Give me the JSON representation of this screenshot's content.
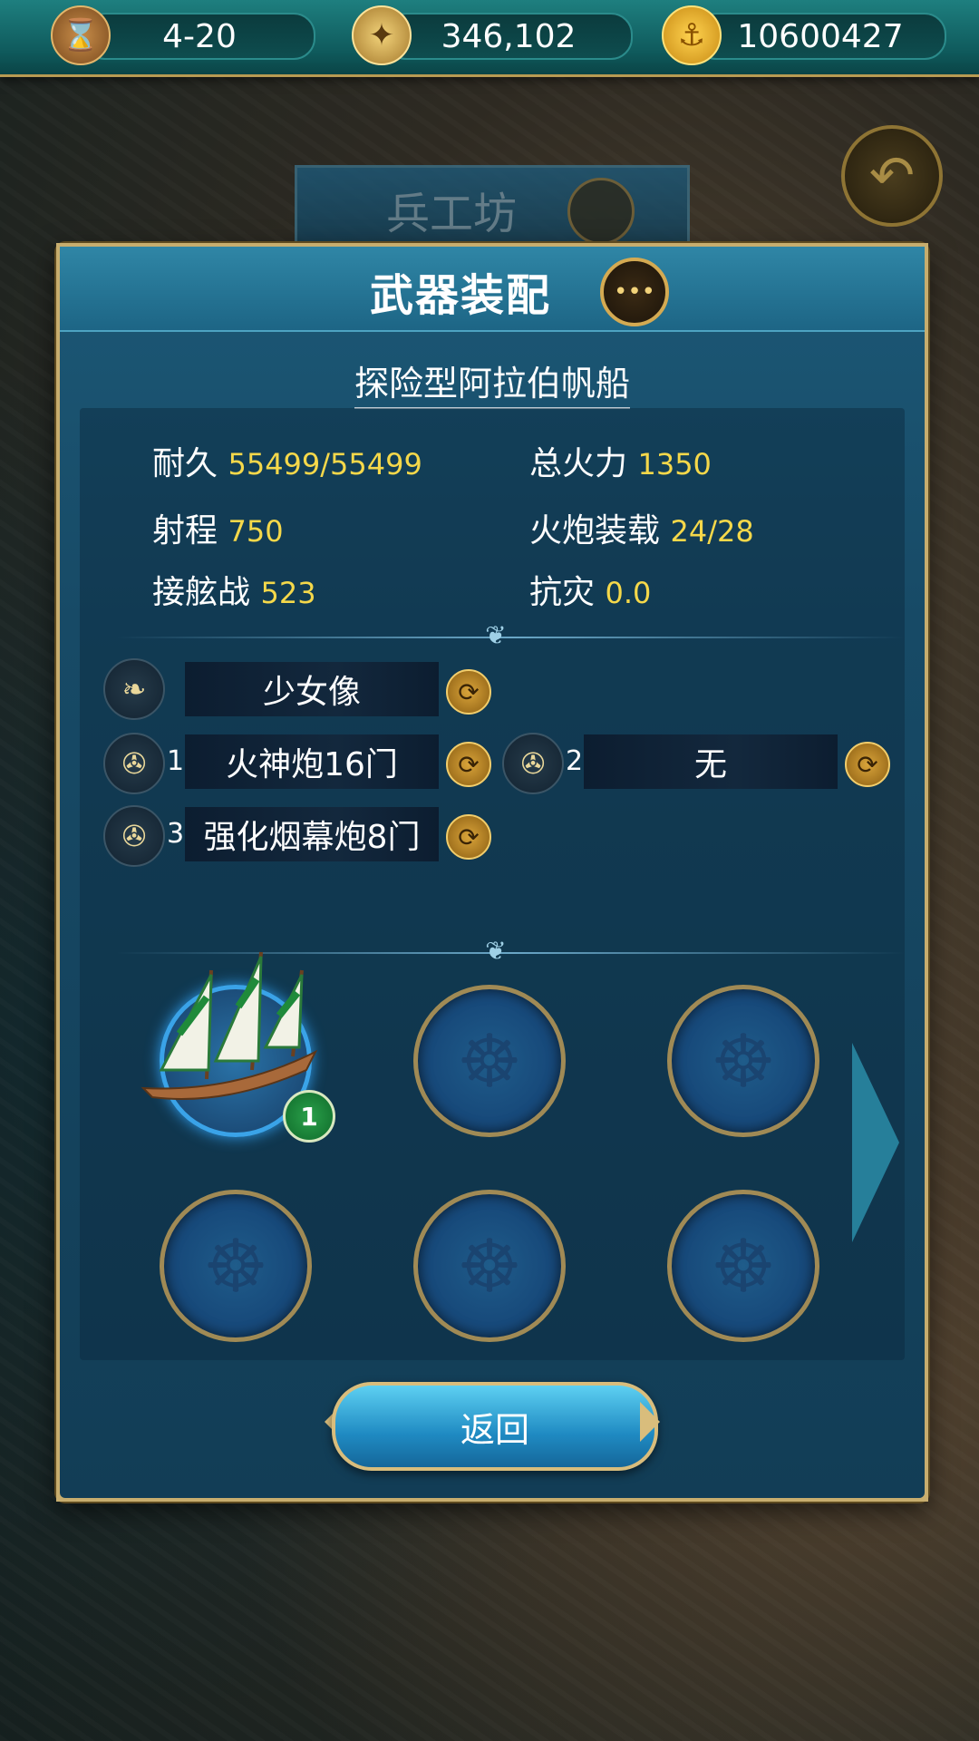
{
  "topbar": {
    "date": "4-20",
    "reputation": "346,102",
    "gold": "10600427",
    "icons": [
      "hourglass-icon",
      "compass-icon",
      "anchor-coin-icon"
    ]
  },
  "background": {
    "title": "兵工坊"
  },
  "panel": {
    "title": "武器装配",
    "ship_name": "探险型阿拉伯帆船",
    "stats": [
      {
        "label": "耐久",
        "value": "55499/55499"
      },
      {
        "label": "总火力",
        "value": "1350"
      },
      {
        "label": "射程",
        "value": "750"
      },
      {
        "label": "火炮装载",
        "value": "24/28"
      },
      {
        "label": "接舷战",
        "value": "523"
      },
      {
        "label": "抗灾",
        "value": "0.0"
      }
    ],
    "figurehead": {
      "value": "少女像"
    },
    "cannon_slots": [
      {
        "num": "1",
        "value": "火神炮16门"
      },
      {
        "num": "2",
        "value": "无"
      },
      {
        "num": "3",
        "value": "强化烟幕炮8门"
      }
    ],
    "fleet": {
      "selected_badge": "1"
    },
    "return_label": "返回"
  },
  "colors": {
    "accent_gold": "#c7ad6e",
    "value_yellow": "#f5d84a",
    "panel_blue": "#174a66",
    "button_blue": "#1f8ac2"
  }
}
